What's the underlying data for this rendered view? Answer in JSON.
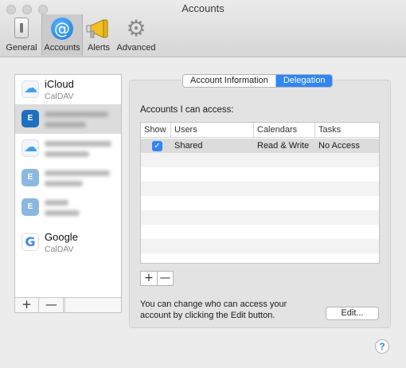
{
  "window": {
    "title": "Accounts"
  },
  "toolbar": {
    "items": [
      {
        "label": "General",
        "icon": "switch-icon"
      },
      {
        "label": "Accounts",
        "icon": "at-sign-icon"
      },
      {
        "label": "Alerts",
        "icon": "megaphone-icon"
      },
      {
        "label": "Advanced",
        "icon": "gear-icon"
      }
    ],
    "active": "Accounts",
    "at_glyph": "@",
    "gear_glyph": "⚙"
  },
  "accounts": {
    "items": [
      {
        "name": "iCloud",
        "type": "CalDAV",
        "logo": "icloud"
      },
      {
        "name": "",
        "type": "",
        "logo": "exchange",
        "redacted": true
      },
      {
        "name": "",
        "type": "",
        "logo": "icloud",
        "redacted": true
      },
      {
        "name": "",
        "type": "",
        "logo": "exchange",
        "redacted": true
      },
      {
        "name": "",
        "type": "",
        "logo": "exchange",
        "redacted": true
      },
      {
        "name": "Google",
        "type": "CalDAV",
        "logo": "google"
      }
    ],
    "selected_index": 1,
    "exchange_glyph": "E",
    "google_glyph": "G",
    "add_label": "+",
    "remove_label": "—"
  },
  "tabs": {
    "items": [
      "Account Information",
      "Delegation"
    ],
    "active": "Delegation"
  },
  "delegation": {
    "access_label": "Accounts I can access:",
    "columns": [
      "Show",
      "Users",
      "Calendars",
      "Tasks"
    ],
    "rows": [
      {
        "show": true,
        "user": "Shared",
        "calendars": "Read & Write",
        "tasks": "No Access"
      }
    ],
    "check_glyph": "✓",
    "add_label": "+",
    "remove_label": "—",
    "help_text": "You can change who can access your account by clicking the Edit button.",
    "edit_label": "Edit..."
  },
  "help": {
    "label": "?"
  },
  "colors": {
    "accent": "#2f86f6",
    "selected_row": "#dcdcdc"
  }
}
